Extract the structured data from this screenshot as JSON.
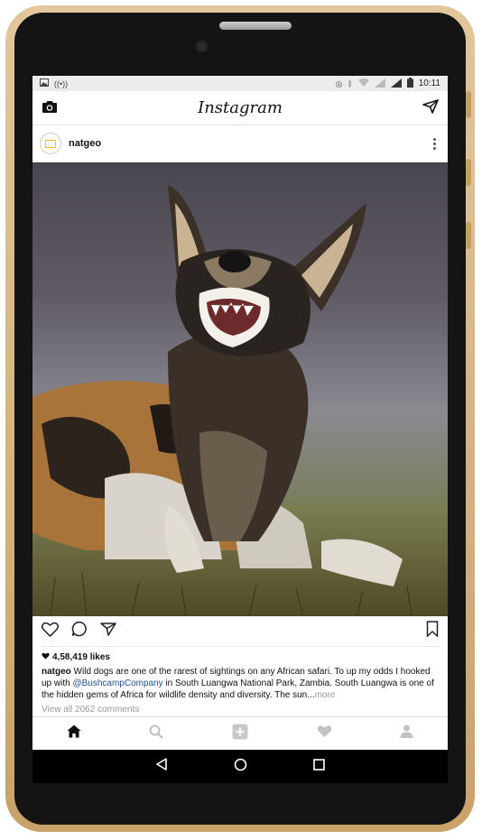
{
  "status_bar": {
    "time": "10:11",
    "left_icons": [
      "image-icon",
      "hotspot-icon"
    ],
    "right_icons": [
      "nfc-icon",
      "bluetooth-icon",
      "wifi-icon",
      "signal-4g-icon",
      "signal-icon",
      "battery-icon"
    ]
  },
  "app_bar": {
    "title": "Instagram",
    "left_icon": "camera-icon",
    "right_icon": "direct-send-icon"
  },
  "post": {
    "username": "natgeo",
    "likes": "4,58,419 likes",
    "caption": {
      "username": "natgeo",
      "text_before_mention": " Wild dogs are one of the rarest of sightings on any African safari. To up my odds I hooked up with ",
      "mention": "@BushcampCompany",
      "text_after_mention": " in South  Luangwa National Park, Zambia. South Luangwa is one of the hidden gems of Africa for wildlife density and diversity. The sun",
      "ellipsis": "...",
      "more_label": "more"
    },
    "view_all_comments": "View all 2062 comments"
  },
  "colors": {
    "mention": "#1e4f8c",
    "device_frame": "#d9b888",
    "muted_text": "#999999"
  },
  "tab_bar": [
    "home-icon",
    "search-icon",
    "add-post-icon",
    "activity-heart-icon",
    "profile-icon"
  ],
  "nav_bar": [
    "back-icon",
    "home-circle-icon",
    "recents-icon"
  ]
}
